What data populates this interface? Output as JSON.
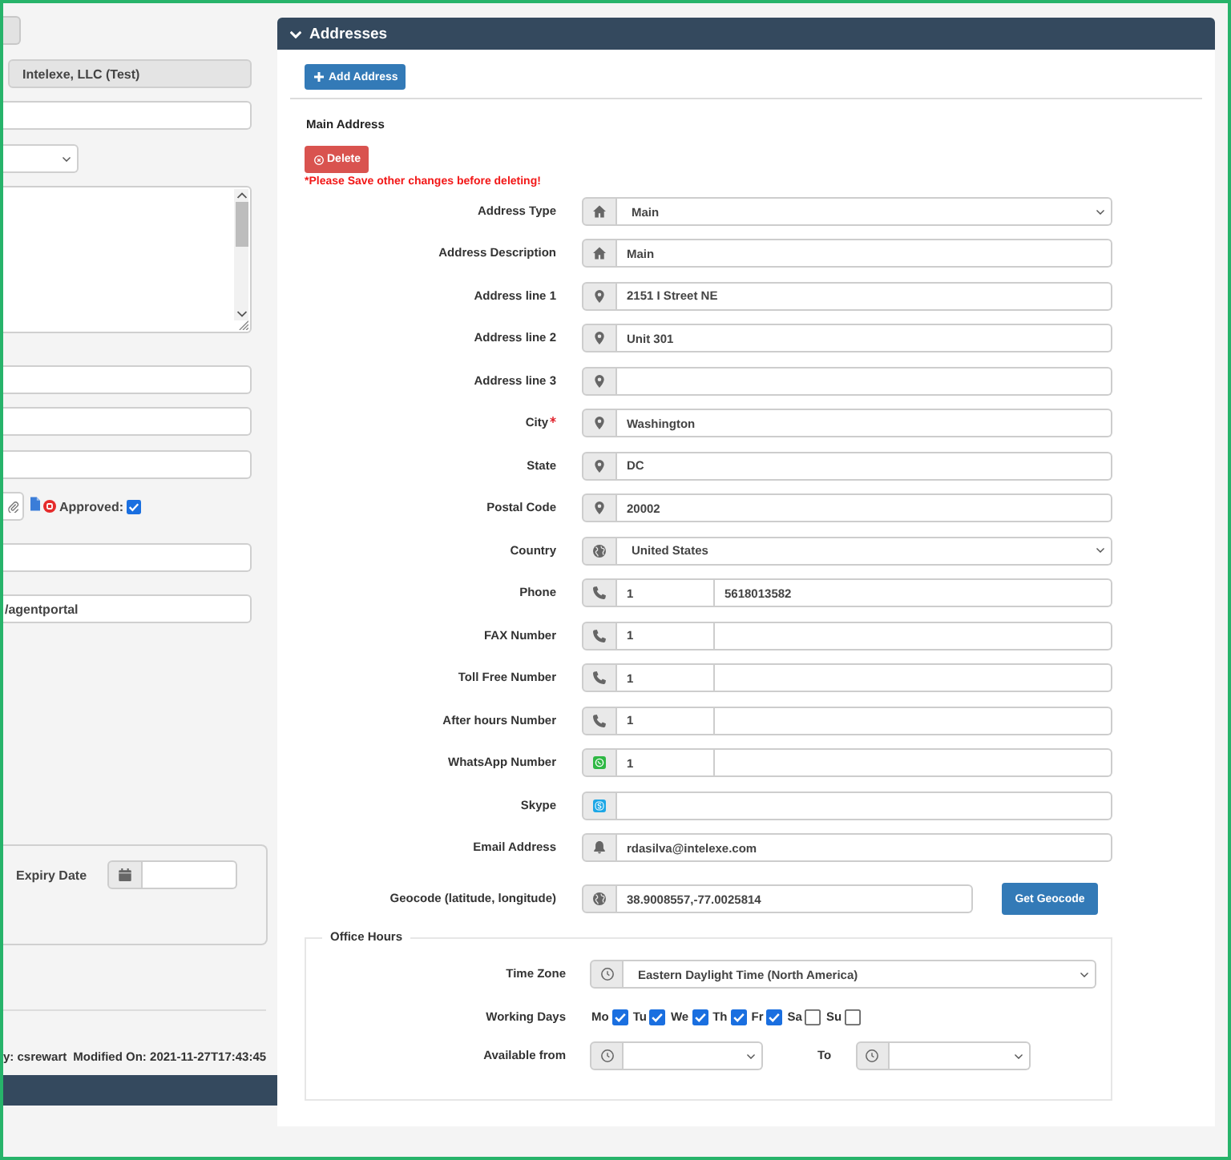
{
  "left_panel": {
    "fields": [
      {
        "kind": "input",
        "disabled": true,
        "value": "Intelexe, LLC (Test)"
      },
      {
        "kind": "input",
        "disabled": false
      },
      {
        "kind": "select"
      },
      {
        "kind": "textarea"
      },
      {
        "kind": "input",
        "disabled": false
      },
      {
        "kind": "input",
        "disabled": false
      },
      {
        "kind": "input",
        "disabled": false
      },
      {
        "kind": "attachment",
        "label": "Approved:",
        "checked": true
      },
      {
        "kind": "input",
        "disabled": false
      },
      {
        "kind": "input",
        "disabled": false,
        "value": "/agentportal"
      }
    ],
    "expiry_date": {
      "label": "Expiry Date"
    },
    "modified_by": "y: csrewart",
    "modified_on": "Modified On: 2021-11-27T17:43:45"
  },
  "addresses_panel": {
    "title": "Addresses",
    "expanded": true,
    "add_button": "Add Address",
    "section_title": "Main Address",
    "delete_button": "Delete",
    "warning": "*Please Save other changes before deleting!",
    "fields": [
      {
        "label": "Address Type",
        "kind": "select",
        "required": false,
        "value": "Main"
      },
      {
        "label": "Address Description",
        "kind": "text",
        "required": false,
        "value": "Main"
      },
      {
        "label": "Address line 1",
        "kind": "text",
        "required": false,
        "value": "2151 I Street NE"
      },
      {
        "label": "Address line 2",
        "kind": "text",
        "required": false,
        "value": "Unit 301"
      },
      {
        "label": "Address line 3",
        "kind": "text",
        "required": false
      },
      {
        "label": "City",
        "kind": "text",
        "required": true,
        "value": "Washington"
      },
      {
        "label": "State",
        "kind": "text",
        "required": false,
        "value": "DC"
      },
      {
        "label": "Postal Code",
        "kind": "text",
        "required": false,
        "value": "20002"
      },
      {
        "label": "Country",
        "kind": "select",
        "required": false,
        "value": "United States"
      },
      {
        "label": "Phone",
        "kind": "phone",
        "required": false,
        "code": "1",
        "value": "5618013582"
      },
      {
        "label": "FAX Number",
        "kind": "phone",
        "required": false,
        "code": "1"
      },
      {
        "label": "Toll Free Number",
        "kind": "phone",
        "required": false,
        "code": "1"
      },
      {
        "label": "After hours Number",
        "kind": "phone",
        "required": false,
        "code": "1"
      },
      {
        "label": "WhatsApp Number",
        "kind": "phone",
        "required": false,
        "code": "1"
      },
      {
        "label": "Skype",
        "kind": "text",
        "required": false
      },
      {
        "label": "Email Address",
        "kind": "text",
        "required": false,
        "value": "rdasilva@intelexe.com"
      }
    ],
    "geocode": {
      "label": "Geocode (latitude, longitude)",
      "value": "38.9008557,-77.0025814",
      "button": "Get Geocode"
    },
    "office_hours": {
      "legend": "Office Hours",
      "time_zone": {
        "label": "Time Zone",
        "value": "Eastern Daylight Time (North America)"
      },
      "working_days": {
        "label": "Working Days",
        "days": [
          {
            "label": "Mo",
            "checked": true
          },
          {
            "label": "Tu",
            "checked": true
          },
          {
            "label": "We",
            "checked": true
          },
          {
            "label": "Th",
            "checked": true
          },
          {
            "label": "Fr",
            "checked": true
          },
          {
            "label": "Sa",
            "checked": false
          },
          {
            "label": "Su",
            "checked": false
          }
        ]
      },
      "available": {
        "label": "Available from",
        "to_label": "To"
      }
    }
  }
}
